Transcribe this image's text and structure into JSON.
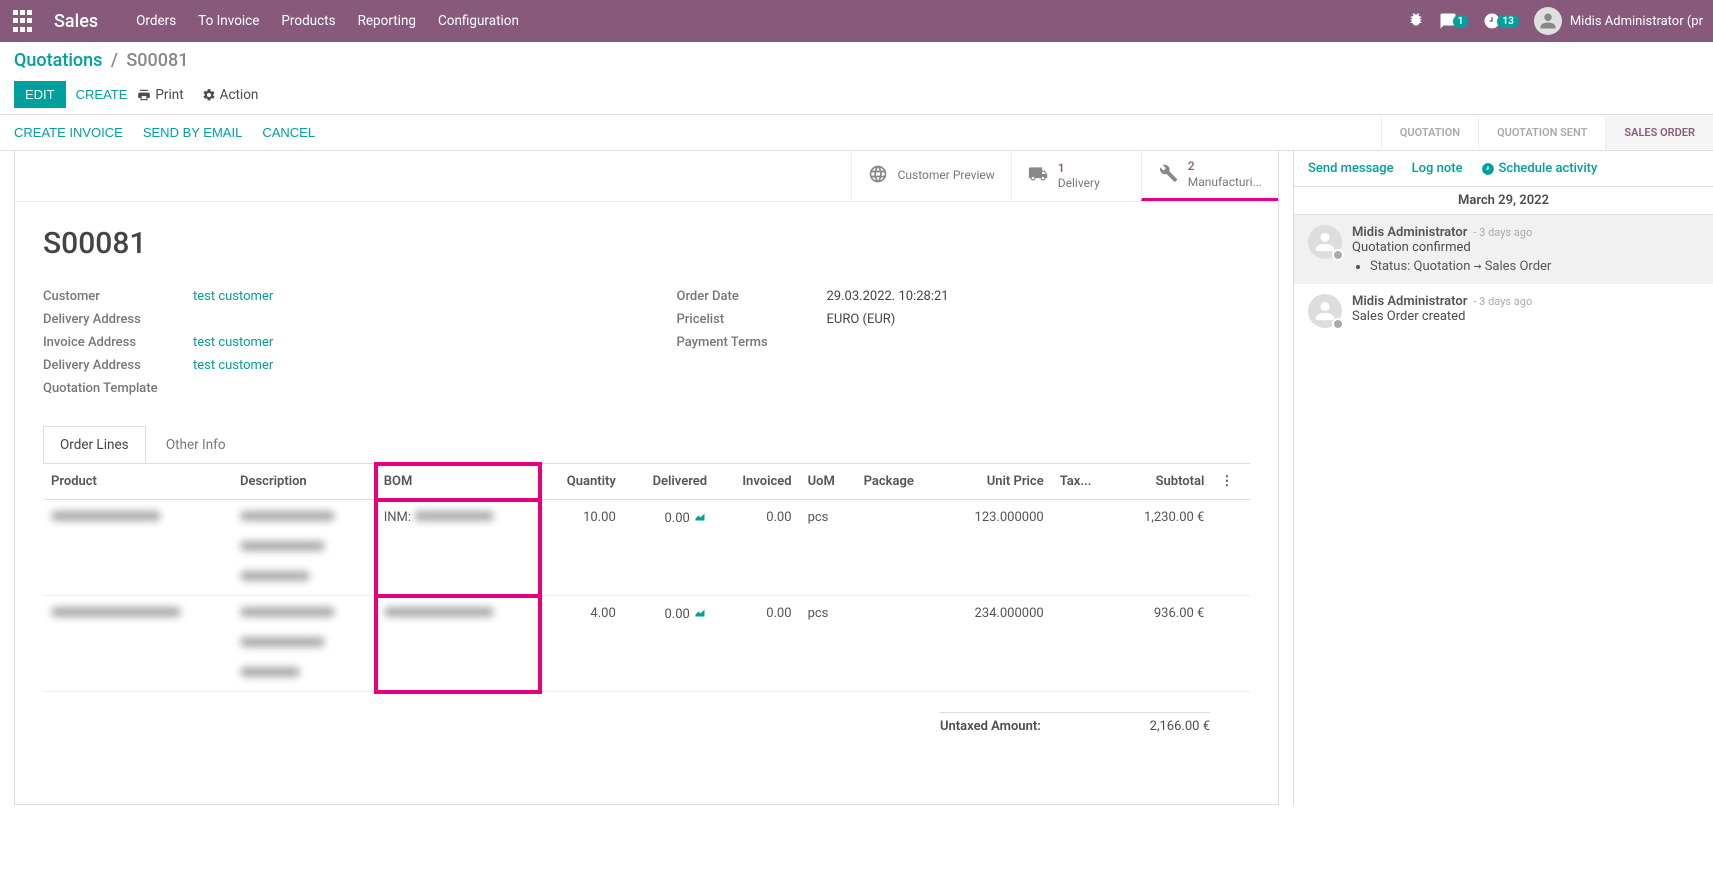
{
  "navbar": {
    "brand": "Sales",
    "menu": [
      "Orders",
      "To Invoice",
      "Products",
      "Reporting",
      "Configuration"
    ],
    "msg_badge": "1",
    "activity_badge": "13",
    "user": "Midis Administrator (pr"
  },
  "breadcrumb": {
    "root": "Quotations",
    "current": "S00081"
  },
  "buttons": {
    "edit": "Edit",
    "create": "Create",
    "print": "Print",
    "action": "Action"
  },
  "statusbar": {
    "actions": [
      "Create Invoice",
      "Send by Email",
      "Cancel"
    ],
    "stages": [
      "Quotation",
      "Quotation Sent",
      "Sales Order"
    ],
    "active_index": 2
  },
  "stat_buttons": {
    "preview": "Customer Preview",
    "delivery_count": "1",
    "delivery_label": "Delivery",
    "manuf_count": "2",
    "manuf_label": "Manufacturi..."
  },
  "title": "S00081",
  "fields_left": {
    "customer_label": "Customer",
    "customer_value": "test customer",
    "delivery_addr_label": "Delivery Address",
    "delivery_addr_value": "",
    "invoice_addr_label": "Invoice Address",
    "invoice_addr_value": "test customer",
    "delivery_addr2_label": "Delivery Address",
    "delivery_addr2_value": "test customer",
    "qtpl_label": "Quotation Template",
    "qtpl_value": ""
  },
  "fields_right": {
    "order_date_label": "Order Date",
    "order_date_value": "29.03.2022. 10:28:21",
    "pricelist_label": "Pricelist",
    "pricelist_value": "EURO (EUR)",
    "payment_terms_label": "Payment Terms",
    "payment_terms_value": ""
  },
  "tabs": [
    "Order Lines",
    "Other Info"
  ],
  "table": {
    "headers": {
      "product": "Product",
      "description": "Description",
      "bom": "BOM",
      "quantity": "Quantity",
      "delivered": "Delivered",
      "invoiced": "Invoiced",
      "uom": "UoM",
      "package": "Package",
      "unit_price": "Unit Price",
      "taxes": "Tax...",
      "subtotal": "Subtotal"
    },
    "rows": [
      {
        "bom_prefix": "INM:",
        "quantity": "10.00",
        "delivered": "0.00",
        "invoiced": "0.00",
        "uom": "pcs",
        "unit_price": "123.000000",
        "subtotal": "1,230.00 €"
      },
      {
        "bom_prefix": "",
        "quantity": "4.00",
        "delivered": "0.00",
        "invoiced": "0.00",
        "uom": "pcs",
        "unit_price": "234.000000",
        "subtotal": "936.00 €"
      }
    ]
  },
  "totals": {
    "untaxed_label": "Untaxed Amount:",
    "untaxed_value": "2,166.00 €"
  },
  "chatter": {
    "send": "Send message",
    "log": "Log note",
    "schedule": "Schedule activity",
    "date": "March 29, 2022",
    "msgs": [
      {
        "author": "Midis Administrator",
        "time": "- 3 days ago",
        "body": "Quotation confirmed",
        "status_line_prefix": "Status: Quotation",
        "status_line_suffix": "Sales Order",
        "highlight": true
      },
      {
        "author": "Midis Administrator",
        "time": "- 3 days ago",
        "body": "Sales Order created",
        "highlight": false
      }
    ]
  }
}
